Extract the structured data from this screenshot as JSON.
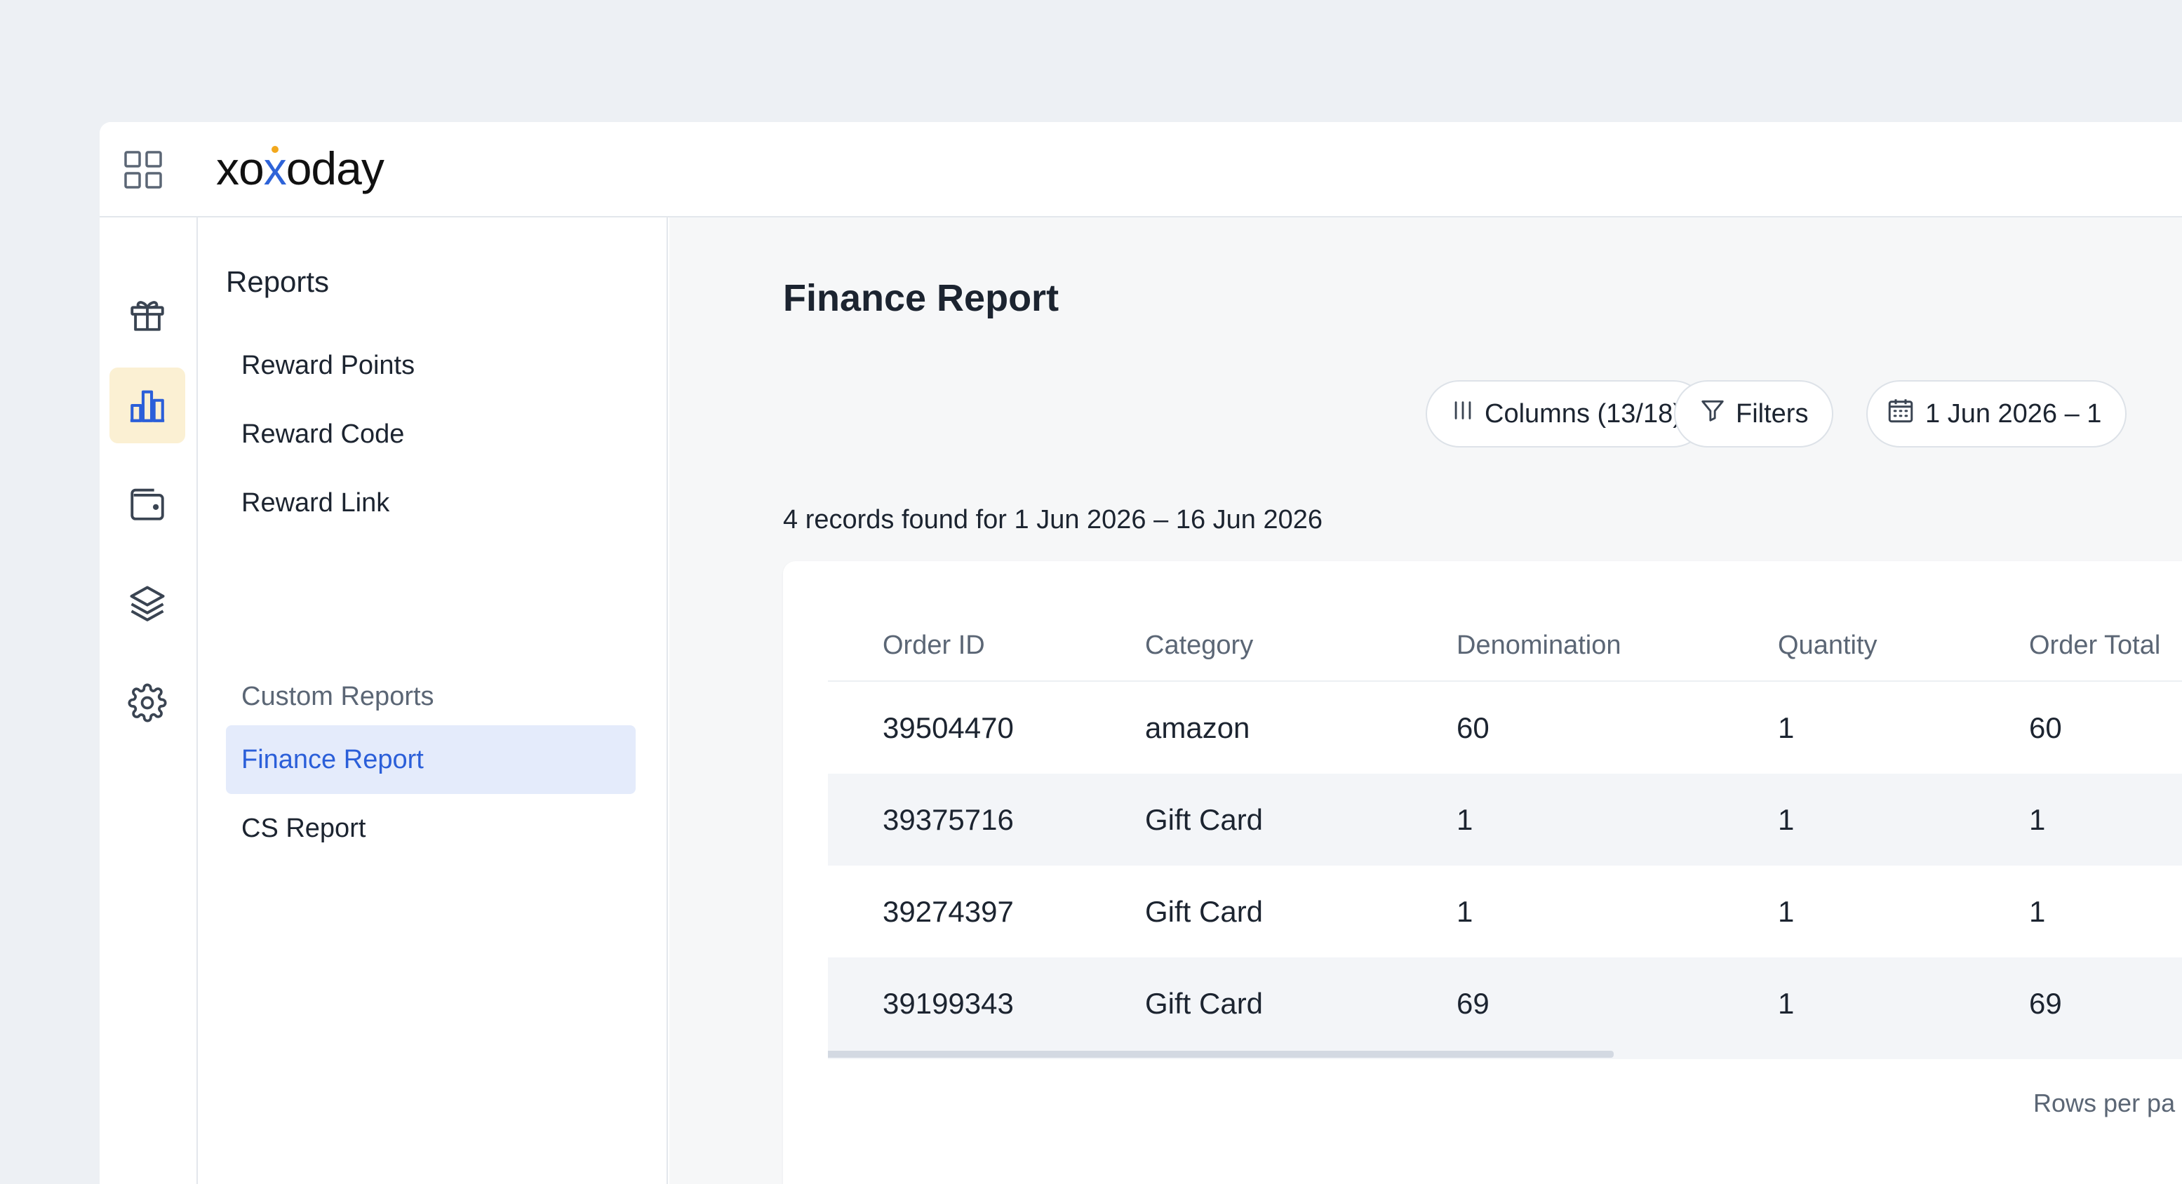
{
  "brand": {
    "logo_left": "xo",
    "logo_x": "x",
    "logo_right": "oday"
  },
  "icons": {
    "apps": "grid-icon",
    "rail": [
      "gift-icon",
      "bar-chart-icon",
      "wallet-icon",
      "layers-icon",
      "gear-icon"
    ],
    "columns": "columns-icon",
    "filters": "filter-icon",
    "date": "calendar-icon"
  },
  "colors": {
    "accent": "#2b5fd9",
    "rail_active_bg": "#fbf0d3",
    "nav_active_bg": "#e4ebfb"
  },
  "subnav": {
    "title": "Reports",
    "items": [
      {
        "label": "Reward Points"
      },
      {
        "label": "Reward Code"
      },
      {
        "label": "Reward Link"
      }
    ],
    "section_label": "Custom Reports",
    "custom_items": [
      {
        "label": "Finance Report",
        "active": true
      },
      {
        "label": "CS Report",
        "active": false
      }
    ]
  },
  "main": {
    "title": "Finance Report",
    "toolbar": {
      "columns_label": "Columns (13/18)",
      "filters_label": "Filters",
      "date_label": "1 Jun 2026 – 1"
    },
    "records_text": "4 records found for 1 Jun 2026 – 16 Jun 2026",
    "table": {
      "columns": [
        "Order ID",
        "Category",
        "Denomination",
        "Quantity",
        "Order Total"
      ],
      "rows": [
        [
          "39504470",
          "amazon",
          "60",
          "1",
          "60"
        ],
        [
          "39375716",
          "Gift Card",
          "1",
          "1",
          "1"
        ],
        [
          "39274397",
          "Gift Card",
          "1",
          "1",
          "1"
        ],
        [
          "39199343",
          "Gift Card",
          "69",
          "1",
          "69"
        ]
      ]
    },
    "pagination": {
      "rows_per_page_label": "Rows per pa"
    }
  }
}
